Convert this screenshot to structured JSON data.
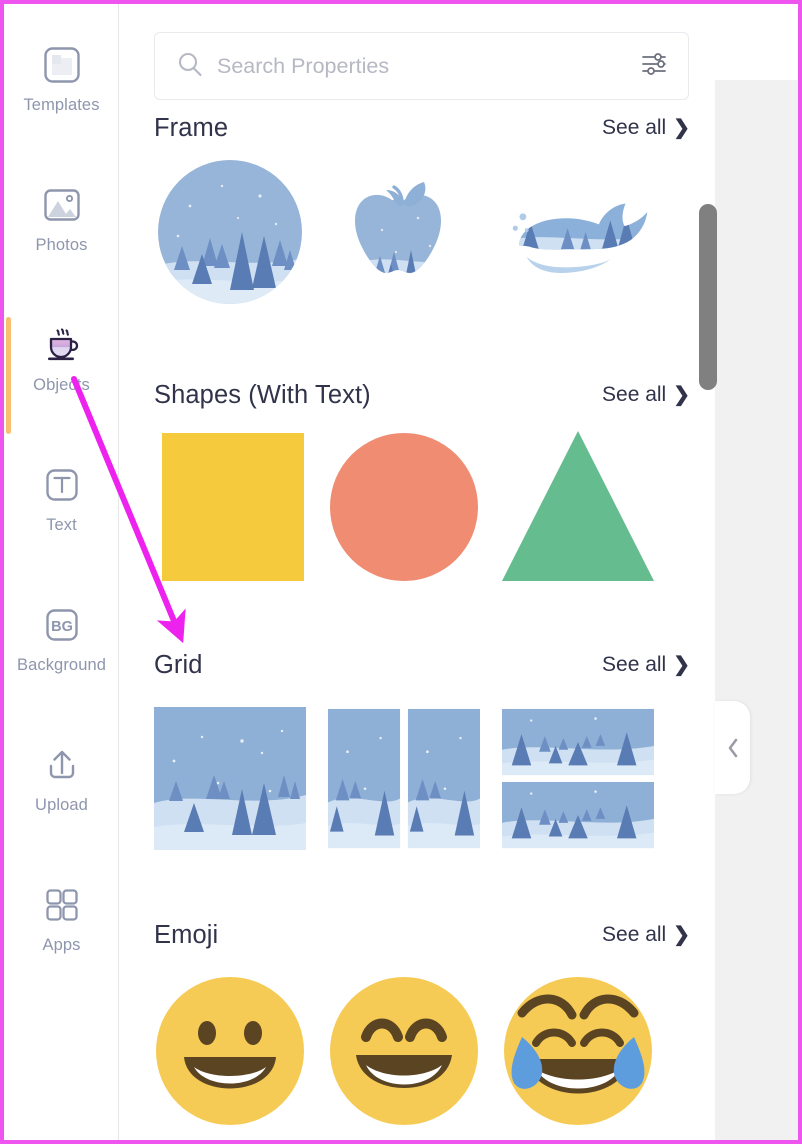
{
  "app": {
    "accent_annotation_color": "#ee44ee",
    "active_indicator_color": "#f7bf6e",
    "panel_background": "#ffffff",
    "canvas_background": "#f1f1f1"
  },
  "sidebar": {
    "items": [
      {
        "id": "templates",
        "label": "Templates",
        "icon": "templates-icon",
        "active": false
      },
      {
        "id": "photos",
        "label": "Photos",
        "icon": "photo-icon",
        "active": false
      },
      {
        "id": "objects",
        "label": "Objects",
        "icon": "coffee-cup-icon",
        "active": true
      },
      {
        "id": "text",
        "label": "Text",
        "icon": "text-t-icon",
        "active": false
      },
      {
        "id": "background",
        "label": "Background",
        "icon": "bg-icon",
        "active": false
      },
      {
        "id": "upload",
        "label": "Upload",
        "icon": "upload-icon",
        "active": false
      },
      {
        "id": "apps",
        "label": "Apps",
        "icon": "apps-grid-icon",
        "active": false
      }
    ]
  },
  "search": {
    "placeholder": "Search Properties",
    "value": "",
    "search_icon": "search-icon",
    "filter_icon": "sliders-filter-icon"
  },
  "sections": [
    {
      "id": "frame",
      "title": "Frame",
      "see_all_label": "See all",
      "see_all_chevron": "❯",
      "clipped": true,
      "items": [
        {
          "id": "frame-circle",
          "name": "circle-winter-frame"
        },
        {
          "id": "frame-apple",
          "name": "apple-winter-frame"
        },
        {
          "id": "frame-whale",
          "name": "whale-winter-frame"
        }
      ]
    },
    {
      "id": "shapes",
      "title": "Shapes (With Text)",
      "see_all_label": "See all",
      "see_all_chevron": "❯",
      "clipped": false,
      "items": [
        {
          "id": "shape-square",
          "name": "yellow-square-shape",
          "color": "#f5ca3c"
        },
        {
          "id": "shape-circle",
          "name": "salmon-circle-shape",
          "color": "#ef8c72"
        },
        {
          "id": "shape-triangle",
          "name": "green-triangle-shape",
          "color": "#65bd8f"
        }
      ]
    },
    {
      "id": "grid",
      "title": "Grid",
      "see_all_label": "See all",
      "see_all_chevron": "❯",
      "clipped": false,
      "items": [
        {
          "id": "grid-single",
          "name": "single-cell-grid"
        },
        {
          "id": "grid-2col",
          "name": "two-column-grid"
        },
        {
          "id": "grid-2row",
          "name": "two-row-grid"
        }
      ]
    },
    {
      "id": "emoji",
      "title": "Emoji",
      "see_all_label": "See all",
      "see_all_chevron": "❯",
      "clipped": false,
      "items": [
        {
          "id": "emoji-grin",
          "name": "grinning-face-emoji",
          "glyph": "😀"
        },
        {
          "id": "emoji-beam",
          "name": "grinning-smiling-eyes-emoji",
          "glyph": "😄"
        },
        {
          "id": "emoji-joy",
          "name": "face-with-tears-of-joy-emoji",
          "glyph": "😂"
        }
      ]
    }
  ],
  "panel_controls": {
    "collapse_chevron": "‹",
    "scrollbar": "vertical-scrollbar"
  }
}
